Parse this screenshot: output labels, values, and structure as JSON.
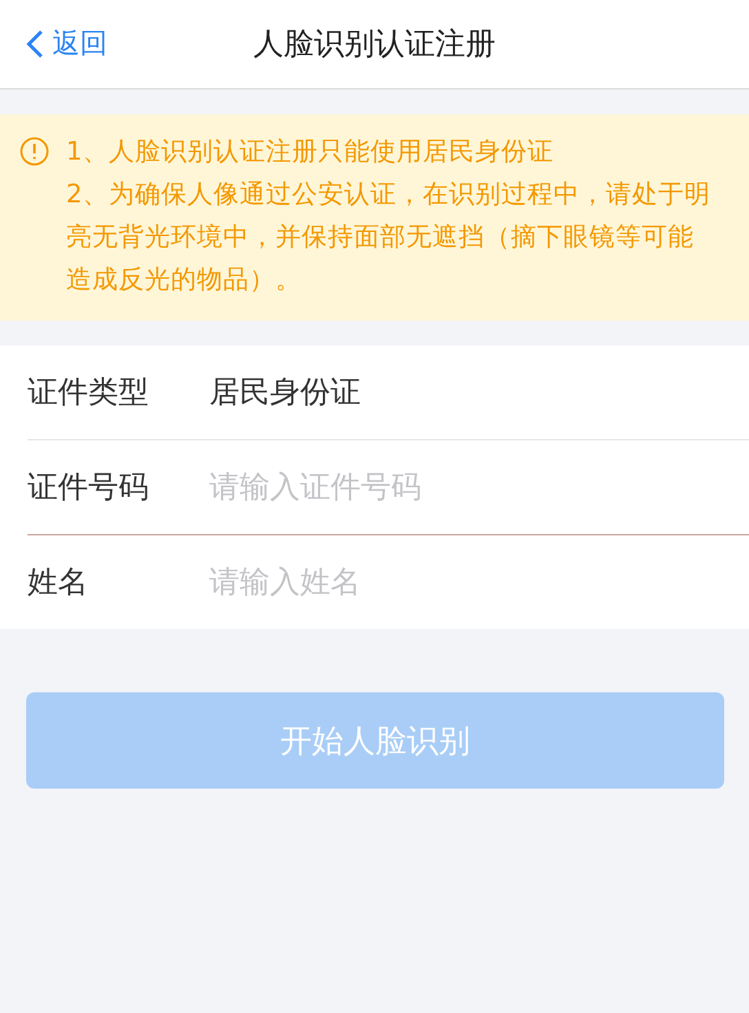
{
  "nav": {
    "back": "返回",
    "title": "人脸识别认证注册"
  },
  "notice": {
    "items": [
      "1、人脸识别认证注册只能使用居民身份证",
      "2、为确保人像通过公安认证，在识别过程中，请处于明亮无背光环境中，并保持面部无遮挡（摘下眼镜等可能造成反光的物品）。"
    ]
  },
  "form": [
    {
      "label": "证件类型",
      "value": "居民身份证",
      "focused": false
    },
    {
      "label": "证件号码",
      "placeholder": "请输入证件号码",
      "focused": true
    },
    {
      "label": "姓名",
      "placeholder": "请输入姓名",
      "focused": false
    }
  ],
  "submit": {
    "label": "开始人脸识别",
    "disabled": true
  }
}
